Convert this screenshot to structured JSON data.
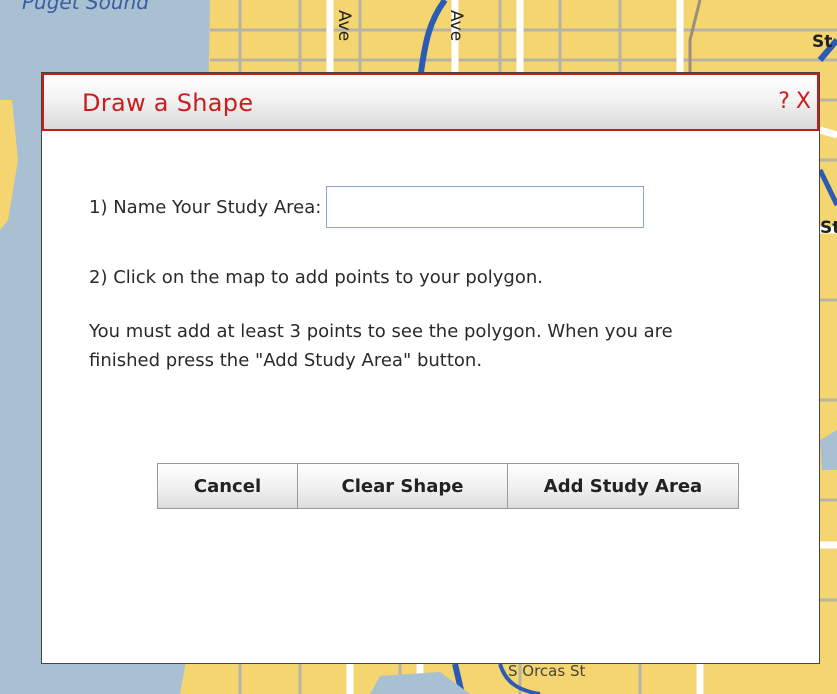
{
  "map": {
    "labels": {
      "puget_sound": "Puget Sound",
      "road_ave_1": "Ave",
      "road_ave_2": "Ave",
      "road_st_top_right": "St",
      "road_st_mid_right": "St",
      "road_orcas": "S Orcas St"
    }
  },
  "dialog": {
    "title": "Draw a Shape",
    "help_glyph": "?",
    "close_glyph": "X",
    "name_label": "1) Name Your Study Area:",
    "name_value": "",
    "step2_text": "2) Click on the map to add points to your polygon.",
    "note_text": "You must add at least 3 points to see the polygon. When you are finished press the \"Add Study Area\" button.",
    "buttons": {
      "cancel": "Cancel",
      "clear": "Clear Shape",
      "add": "Add Study Area"
    }
  },
  "colors": {
    "title_red": "#c81e1e",
    "land": "#f5d56f",
    "water": "#a9bfd2"
  }
}
